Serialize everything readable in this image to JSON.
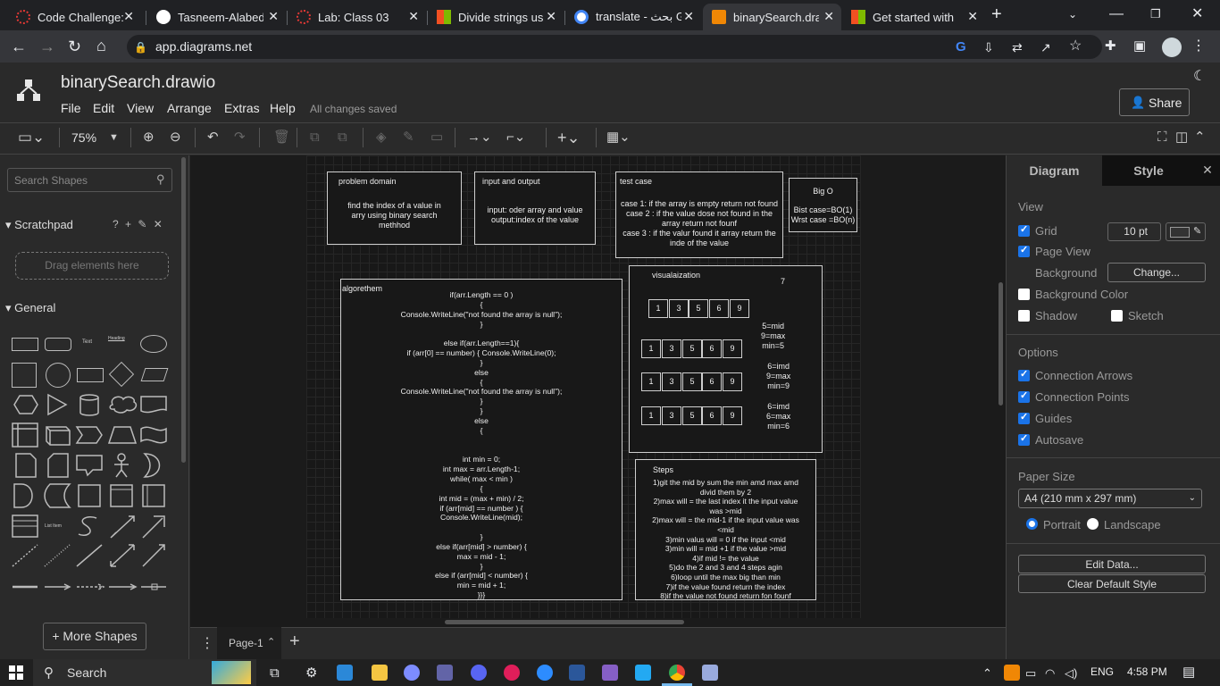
{
  "browser": {
    "tabs": [
      {
        "title": "Code Challenge:",
        "fav": "#e53935"
      },
      {
        "title": "Tasneem-Alabed/",
        "fav": "#ffffff"
      },
      {
        "title": "Lab: Class 03",
        "fav": "#e53935"
      },
      {
        "title": "Divide strings usi",
        "fav": "#f25022"
      },
      {
        "title": "translate - بحث G",
        "fav": "#4285f4"
      },
      {
        "title": "binarySearch.dra",
        "fav": "#f08705"
      },
      {
        "title": "Get started with",
        "fav": "#f25022"
      }
    ],
    "url": "app.diagrams.net"
  },
  "app": {
    "title": "binarySearch.drawio",
    "menus": [
      "File",
      "Edit",
      "View",
      "Arrange",
      "Extras",
      "Help"
    ],
    "save_status": "All changes saved",
    "share": "Share",
    "zoom": "75%"
  },
  "left": {
    "search_placeholder": "Search Shapes",
    "scratchpad": "Scratchpad",
    "scratch_controls": "? + ✎ ✕",
    "drag_here": "Drag elements here",
    "general": "General",
    "shape_text": "Text",
    "shape_heading": "Heading",
    "shape_listitem": "List Item",
    "more_shapes": "+ More Shapes"
  },
  "diagram": {
    "problem_title": "problem domain",
    "problem_body": "find the index of a value in\narry using binary search\nmethhod",
    "io_title": "input and output",
    "io_body": "input: oder array and value\noutput:index of the value",
    "test_title": "test case",
    "test_body": "case 1: if the array is empty return not found\ncase 2 : if the value dose not found in the\narray return not founf\ncase 3 : if the valur found it array return the\ninde of the value",
    "bigo_title": "Big O",
    "bigo_body": "Bist case=BO(1)\nWrst case =BO(n)",
    "algo_title": "algorethem",
    "algo_code": "if(arr.Length == 0 )\n{\nConsole.WriteLine(\"not found the array is null\");\n}\n\nelse if(arr.Length==1){\nif (arr[0] == number) { Console.WriteLine(0);\n}\nelse\n{\nConsole.WriteLine(\"not found the array is null\");\n}\n}\nelse\n{\n\n\nint min = 0;\nint max = arr.Length-1;\nwhile( max < min )\n{\nint mid = (max + min) / 2;\nif (arr[mid] == number ) {\nConsole.WriteLine(mid);\n\n}\nelse if(arr[mid] > number) {\nmax = mid - 1;\n}\nelse if (arr[mid] < number) {\nmin = mid + 1;\n}}}",
    "vis_title": "visualaization",
    "vis_target": "7",
    "array": [
      "1",
      "3",
      "5",
      "6",
      "9"
    ],
    "vis_notes": [
      "5=mid\n9=max\nmin=5",
      "6=imd\n9=max\nmin=9",
      "6=imd\n6=max\nmin=6"
    ],
    "steps_title": "Steps",
    "steps_body": "1)git the mid by sum the min amd max amd\ndivid them by 2\n2)max will = the last index it the input value\nwas >mid\n2)max will = the mid-1 if the input value was\n<mid\n3)min valus will = 0 if the input <mid\n3)min will = mid +1 if the value >mid\n4)if mid != the value\n5)do the 2 and 3 and 4 steps agin\n6)loop until the max big than min\n7)if the value found return the index\n8)if the value not found return fon founf"
  },
  "right": {
    "tab_diagram": "Diagram",
    "tab_style": "Style",
    "view": "View",
    "grid": "Grid",
    "grid_size": "10 pt",
    "page_view": "Page View",
    "background": "Background",
    "change": "Change...",
    "bg_color": "Background Color",
    "shadow": "Shadow",
    "sketch": "Sketch",
    "options": "Options",
    "conn_arrows": "Connection Arrows",
    "conn_points": "Connection Points",
    "guides": "Guides",
    "autosave": "Autosave",
    "paper_size": "Paper Size",
    "paper_value": "A4 (210 mm x 297 mm)",
    "portrait": "Portrait",
    "landscape": "Landscape",
    "edit_data": "Edit Data...",
    "clear_style": "Clear Default Style"
  },
  "pagebar": {
    "page": "Page-1"
  },
  "taskbar": {
    "search": "Search",
    "lang": "ENG",
    "time": "4:58 PM"
  }
}
